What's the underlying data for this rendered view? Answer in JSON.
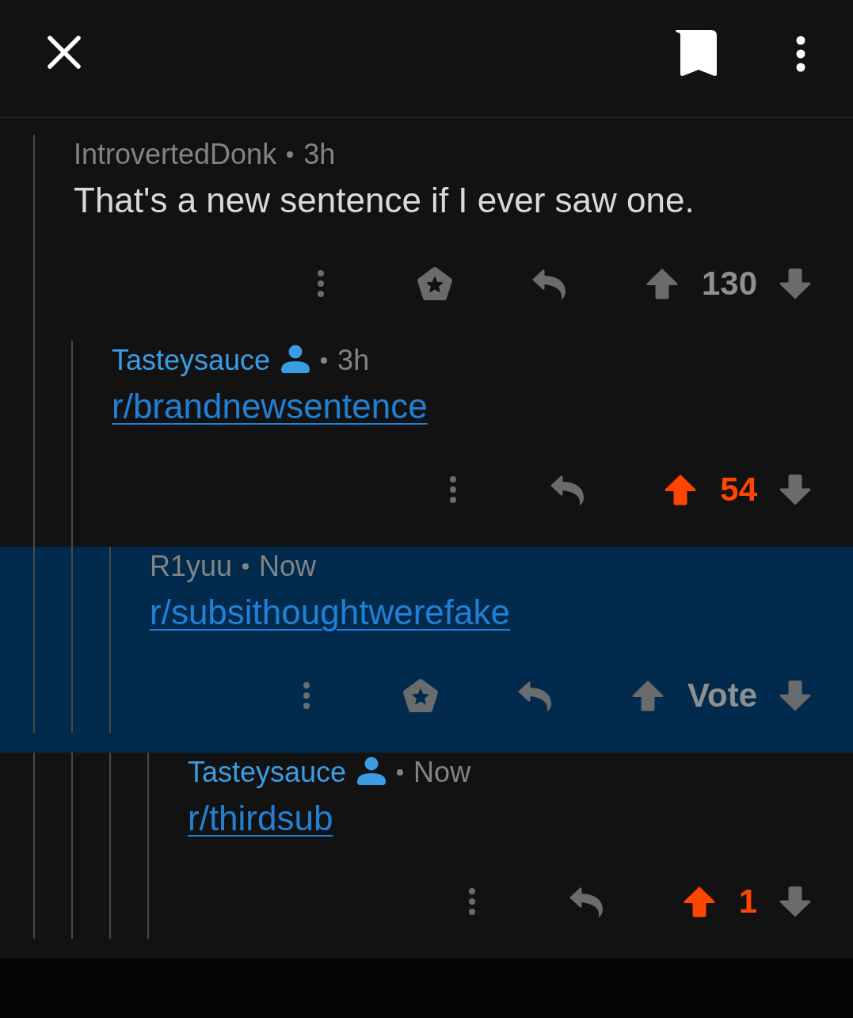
{
  "comments": [
    {
      "author": "IntrovertedDonk",
      "op": false,
      "time": "3h",
      "kind": "text",
      "body": "That's a new sentence if I ever saw one.",
      "award_button": true,
      "score": "130",
      "upvoted": false,
      "highlighted": false,
      "children": [
        {
          "author": "Tasteysauce",
          "op": true,
          "time": "3h",
          "kind": "link",
          "body": "r/brandnewsentence",
          "award_button": false,
          "score": "54",
          "upvoted": true,
          "highlighted": false,
          "children": [
            {
              "author": "R1yuu",
              "op": false,
              "time": "Now",
              "kind": "link",
              "body": "r/subsithoughtwerefake",
              "award_button": true,
              "score": "Vote",
              "upvoted": false,
              "highlighted": true,
              "children": [
                {
                  "author": "Tasteysauce",
                  "op": true,
                  "time": "Now",
                  "kind": "link",
                  "body": "r/thirdsub",
                  "award_button": false,
                  "score": "1",
                  "upvoted": true,
                  "highlighted": false
                }
              ]
            }
          ]
        }
      ]
    }
  ]
}
